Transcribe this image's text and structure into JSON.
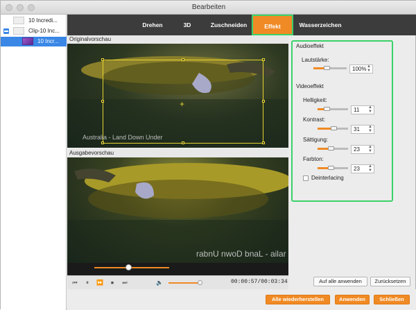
{
  "window": {
    "title": "Bearbeiten"
  },
  "sidebar": {
    "items": [
      {
        "label": "10 Incredi..."
      },
      {
        "label": "Clip-10 Inc..."
      },
      {
        "label": "10 Incr..."
      }
    ]
  },
  "tabs": [
    {
      "label": "Drehen"
    },
    {
      "label": "3D"
    },
    {
      "label": "Zuschneiden"
    },
    {
      "label": "Effekt",
      "active": true
    },
    {
      "label": "Wasserzeichen"
    }
  ],
  "preview": {
    "original_label": "Originalvorschau",
    "output_label": "Ausgabevorschau",
    "watermark_text": "Australia - Land Down Under",
    "watermark_mirrored": "rabnU nwoD bnaL - ailar",
    "progress_fraction": 0.45
  },
  "player": {
    "time": "00:00:57/00:03:34",
    "volume_fraction": 0.92
  },
  "effects": {
    "audio_heading": "Audioeffekt",
    "volume_label": "Lautstärke:",
    "volume_value": "100%",
    "video_heading": "Videoeffekt",
    "brightness_label": "Helligkeit:",
    "brightness_value": "11",
    "contrast_label": "Kontrast:",
    "contrast_value": "31",
    "saturation_label": "Sättigung:",
    "saturation_value": "23",
    "hue_label": "Farbton:",
    "hue_value": "23",
    "deinterlace_label": "Deinterlacing"
  },
  "buttons": {
    "apply_all": "Auf alle anwenden",
    "reset": "Zurücksetzen",
    "restore_all": "Alle wiederherstellen",
    "apply": "Anwenden",
    "close": "Schließen"
  },
  "colors": {
    "accent": "#f08a24",
    "highlight": "#3bd16a",
    "tabbar": "#3c3c3c"
  }
}
